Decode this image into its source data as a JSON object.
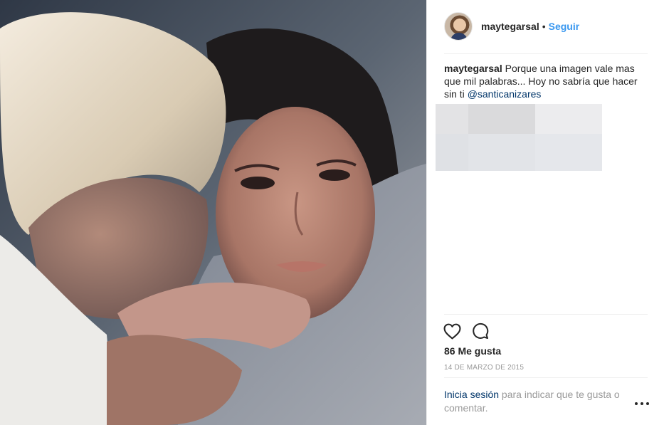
{
  "post": {
    "photo_description_icon": "post-photo",
    "author": "maytegarsal",
    "dot": "•",
    "follow_label": "Seguir",
    "caption": {
      "user": "maytegarsal",
      "text": " Porque una imagen vale mas que mil palabras... Hoy no sabría que hacer sin ti ",
      "mention": "@santicanizares"
    },
    "likes_label": "86 Me gusta",
    "date_label": "14 DE MARZO DE 2015",
    "login": {
      "link": "Inicia sesión",
      "rest": " para indicar que te gusta o comentar."
    }
  },
  "icons": {
    "like": "heart-icon",
    "comment": "comment-icon",
    "more": "more-options-icon"
  },
  "colors": {
    "link_blue": "#3897f0",
    "mention_blue": "#003569",
    "muted": "#999999",
    "text": "#262626"
  }
}
